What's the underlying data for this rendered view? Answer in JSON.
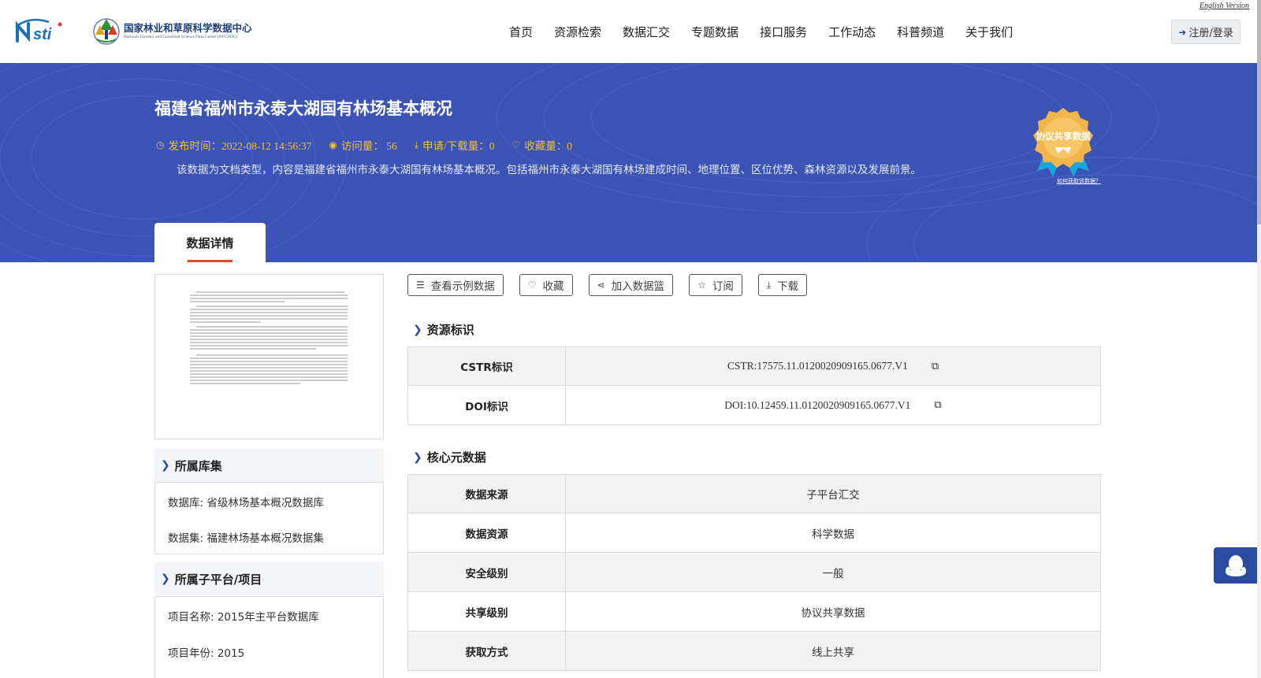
{
  "header": {
    "english_link": "English Version",
    "org_name_cn": "国家林业和草原科学数据中心",
    "org_name_en": "National Forestry and Grassland Science Data Center (NFGSDC)",
    "nav": [
      "首页",
      "资源检索",
      "数据汇交",
      "专题数据",
      "接口服务",
      "工作动态",
      "科普频道",
      "关于我们"
    ],
    "login_label": "注册/登录"
  },
  "banner": {
    "title": "福建省福州市永泰大湖国有林场基本概况",
    "publish_time": "发布时间：2022-08-12 14:56:37",
    "views": "访问量： 56",
    "downloads": "申请/下载量：0",
    "favorites": "收藏量：0",
    "description": "该数据为文档类型，内容是福建省福州市永泰大湖国有林场基本概况。包括福州市永泰大湖国有林场建成时间、地理位置、区位优势、森林资源以及发展前景。",
    "badge_text": "协议共享数据",
    "badge_link": "如何获取该数据？",
    "tab_label": "数据详情"
  },
  "sidebar": {
    "collection_title": "所属库集",
    "database": "数据库: 省级林场基本概况数据库",
    "dataset": "数据集: 福建林场基本概况数据集",
    "platform_title": "所属子平台/项目",
    "project_name": "项目名称: 2015年主平台数据库",
    "project_year": "项目年份: 2015"
  },
  "actions": {
    "sample": "查看示例数据",
    "favorite": "收藏",
    "basket": "加入数据篮",
    "subscribe": "订阅",
    "download": "下载"
  },
  "resource_id": {
    "title": "资源标识",
    "rows": [
      {
        "key": "CSTR标识",
        "value": "CSTR:17575.11.0120020909165.0677.V1"
      },
      {
        "key": "DOI标识",
        "value": "DOI:10.12459.11.0120020909165.0677.V1"
      }
    ]
  },
  "core_meta": {
    "title": "核心元数据",
    "rows": [
      {
        "key": "数据来源",
        "value": "子平台汇交"
      },
      {
        "key": "数据资源",
        "value": "科学数据"
      },
      {
        "key": "安全级别",
        "value": "一般"
      },
      {
        "key": "共享级别",
        "value": "协议共享数据"
      },
      {
        "key": "获取方式",
        "value": "线上共享"
      }
    ]
  },
  "colors": {
    "banner": "#3a53b5",
    "accent": "#f0c040",
    "tab_underline": "#e04a2a",
    "primary": "#2b4ba0"
  }
}
